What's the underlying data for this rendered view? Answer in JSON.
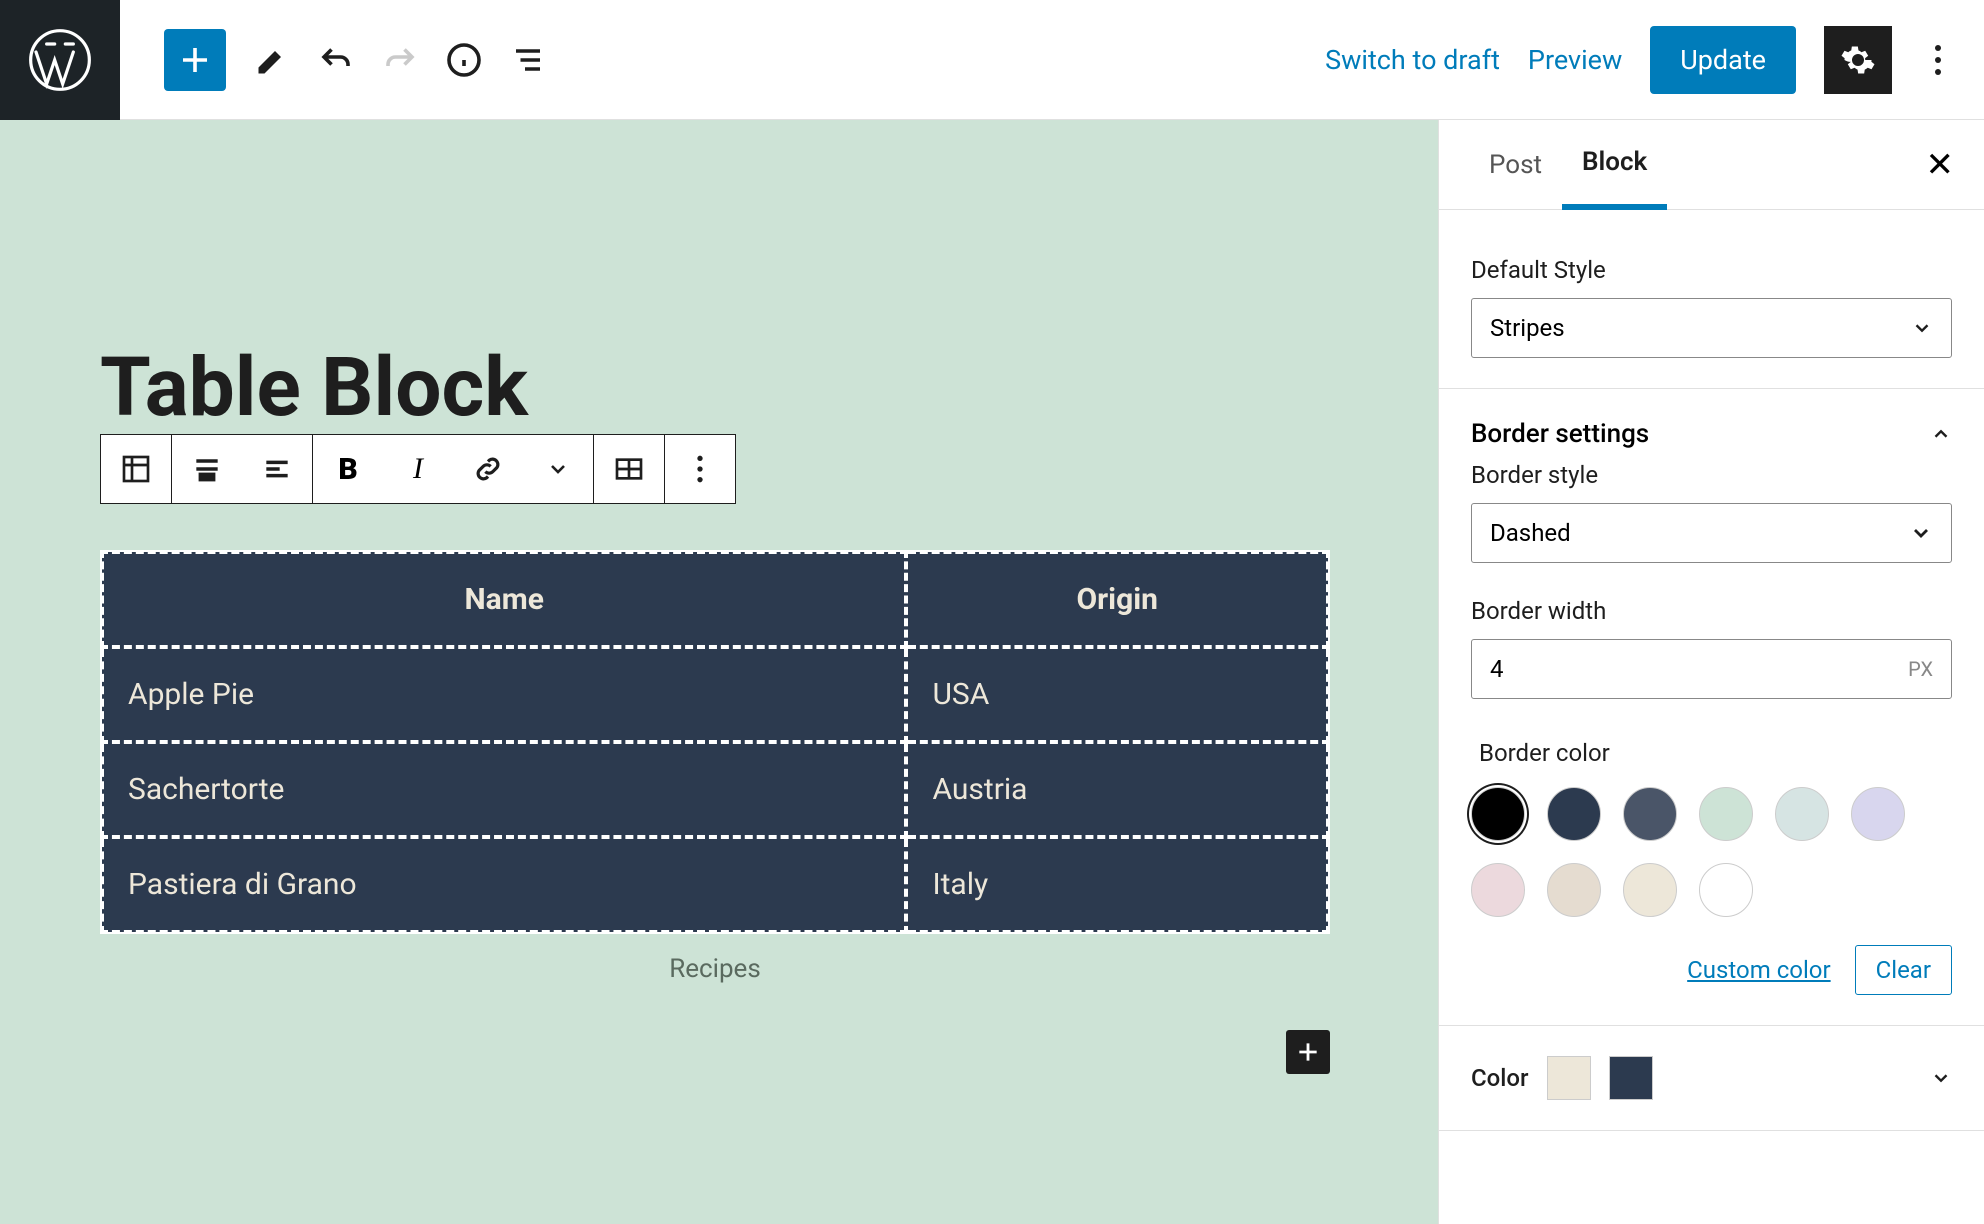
{
  "header": {
    "switch_to_draft": "Switch to draft",
    "preview": "Preview",
    "update": "Update"
  },
  "editor": {
    "page_title": "Table Block",
    "table": {
      "headers": [
        "Name",
        "Origin"
      ],
      "rows": [
        [
          "Apple Pie",
          "USA"
        ],
        [
          "Sachertorte",
          "Austria"
        ],
        [
          "Pastiera di Grano",
          "Italy"
        ]
      ],
      "caption": "Recipes"
    }
  },
  "sidebar": {
    "tabs": {
      "post": "Post",
      "block": "Block"
    },
    "default_style": {
      "label": "Default Style",
      "value": "Stripes"
    },
    "border_settings": {
      "header": "Border settings"
    },
    "border_style": {
      "label": "Border style",
      "value": "Dashed"
    },
    "border_width": {
      "label": "Border width",
      "value": "4",
      "unit": "PX"
    },
    "border_color": {
      "label": "Border color",
      "swatches": [
        "#000000",
        "#2c3a4f",
        "#4a5568",
        "#cde3d6",
        "#d6e4e3",
        "#d8d6ee",
        "#ecd9dd",
        "#e5dcd0",
        "#ede7d9",
        "#ffffff"
      ],
      "selected": 0,
      "custom": "Custom color",
      "clear": "Clear"
    },
    "color": {
      "label": "Color",
      "text_color": "#ede7d9",
      "bg_color": "#2c3a4f"
    }
  }
}
